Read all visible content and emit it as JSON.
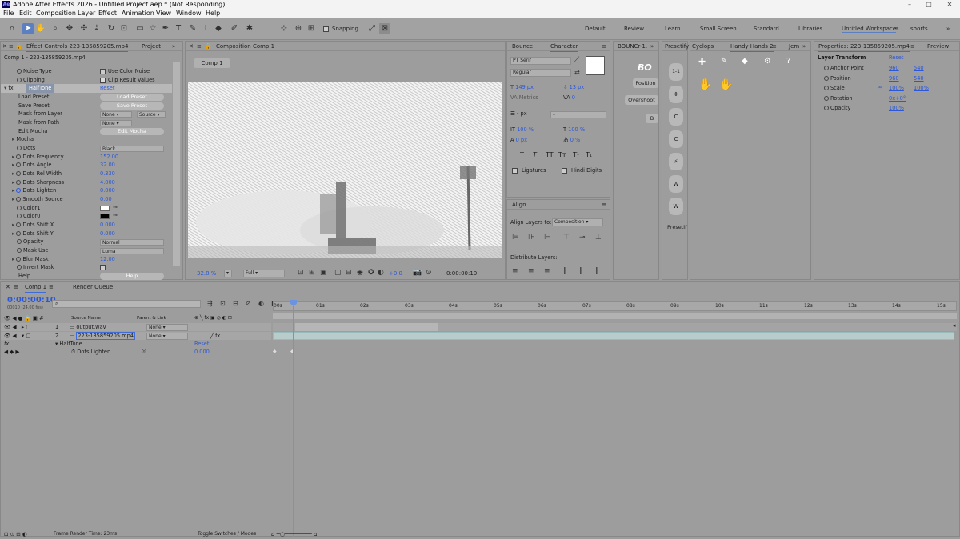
{
  "app": {
    "logo_text": "Ae",
    "title": "Adobe After Effects 2026 - Untitled Project.aep * (Not Responding)"
  },
  "menu": [
    "File",
    "Edit",
    "Composition",
    "Layer",
    "Effect",
    "Animation",
    "View",
    "Window",
    "Help"
  ],
  "toolbar": {
    "snapping_label": "Snapping"
  },
  "workspaces": [
    "Default",
    "Review",
    "Learn",
    "Small Screen",
    "Standard",
    "Libraries",
    "Untitled Workspace",
    "shorts"
  ],
  "effect_controls": {
    "tab_label": "Effect Controls 223-135859205.mp4",
    "project_tab": "Project",
    "breadcrumb": "Comp 1 - 223-135859205.mp4",
    "effect_name": "HalfTone",
    "reset": "Reset",
    "rows": [
      {
        "label": "Noise Type",
        "control": "Use Color Noise"
      },
      {
        "label": "Clipping",
        "control": "Clip Result Values"
      },
      {
        "label": "Load Preset",
        "control": "Load Preset"
      },
      {
        "label": "Save Preset",
        "control": "Save Preset"
      },
      {
        "label": "Mask from Layer",
        "control": "None",
        "control2": "Source"
      },
      {
        "label": "Mask from Path",
        "control": "None"
      },
      {
        "label": "Edit Mocha",
        "control": "Edit Mocha"
      },
      {
        "label": "Mocha",
        "control": ""
      },
      {
        "label": "Dots",
        "control": "Black"
      },
      {
        "label": "Dots Frequency",
        "control": "152.00"
      },
      {
        "label": "Dots Angle",
        "control": "32.00"
      },
      {
        "label": "Dots Rel Width",
        "control": "0.330"
      },
      {
        "label": "Dots Sharpness",
        "control": "4.000"
      },
      {
        "label": "Dots Lighten",
        "control": "0.000"
      },
      {
        "label": "Smooth Source",
        "control": "0.00"
      },
      {
        "label": "Color1",
        "control": ""
      },
      {
        "label": "Color0",
        "control": ""
      },
      {
        "label": "Dots Shift X",
        "control": "0.000"
      },
      {
        "label": "Dots Shift Y",
        "control": "0.000"
      },
      {
        "label": "Opacity",
        "control": "Normal"
      },
      {
        "label": "Mask Use",
        "control": "Luma"
      },
      {
        "label": "Blur Mask",
        "control": "12.00"
      },
      {
        "label": "Invert Mask",
        "control": ""
      },
      {
        "label": "Help",
        "control": "Help"
      }
    ]
  },
  "composition": {
    "tab_label": "Composition Comp 1",
    "comp_chip": "Comp 1",
    "zoom": "32.8 %",
    "resolution": "Full",
    "exposure": "+0.0",
    "timecode": "0:00:00:10"
  },
  "character": {
    "tabs": [
      "Bounce",
      "Character"
    ],
    "font": "PT Serif",
    "style": "Regular",
    "size": "149 px",
    "leading": "13 px",
    "kerning": "Metrics",
    "tracking": "0",
    "stroke": "- px",
    "vscale": "100 %",
    "hscale": "100 %",
    "baseline": "0 px",
    "tsume": "0 %",
    "ligatures": "Ligatures",
    "hindi_digits": "Hindi Digits",
    "type_buttons": [
      "T",
      "T",
      "TT",
      "Tт",
      "T¹",
      "T₁"
    ]
  },
  "align": {
    "title": "Align",
    "align_to_label": "Align Layers to:",
    "align_to_value": "Composition",
    "distribute_label": "Distribute Layers:"
  },
  "bouncr": {
    "tab": "BOUNCr-1.",
    "logo": "BO",
    "position": "Position",
    "overshoot": "Overshoot",
    "b": "B"
  },
  "presets": {
    "tab": "Presetify",
    "footer": "Presetif",
    "buttons": [
      "1-1",
      "⇕",
      "C",
      "C",
      "⚡",
      "W",
      "W"
    ]
  },
  "handy_hands": {
    "tabs": [
      "Cyclops",
      "Handy Hands 2",
      "Jem"
    ]
  },
  "properties": {
    "tab": "Properties: 223-135859205.mp4",
    "preview_tab": "Preview",
    "section": "Layer Transform",
    "reset": "Reset",
    "rows": [
      {
        "label": "Anchor Point",
        "v1": "960",
        "v2": "540"
      },
      {
        "label": "Position",
        "v1": "960",
        "v2": "540"
      },
      {
        "label": "Scale",
        "v1": "100%",
        "v2": "100%"
      },
      {
        "label": "Rotation",
        "v1": "0x+0°",
        "v2": ""
      },
      {
        "label": "Opacity",
        "v1": "100%",
        "v2": ""
      }
    ]
  },
  "timeline": {
    "tab": "Comp 1",
    "render_queue": "Render Queue",
    "timecode": "0:00:00:10",
    "fps_info": "00010 (24.00 fps)",
    "col_source": "Source Name",
    "col_parent": "Parent & Link",
    "layers": [
      {
        "num": "1",
        "name": "output.wav",
        "parent": "None"
      },
      {
        "num": "2",
        "name": "223-135859205.mp4",
        "parent": "None"
      }
    ],
    "effect": "HalfTone",
    "effect_reset": "Reset",
    "prop": "Dots Lighten",
    "prop_value": "0.000",
    "ruler": [
      "00s",
      "01s",
      "02s",
      "03s",
      "04s",
      "05s",
      "06s",
      "07s",
      "08s",
      "09s",
      "10s",
      "11s",
      "12s",
      "13s",
      "14s",
      "15s"
    ],
    "footer_render": "Frame Render Time: 23ms",
    "footer_toggle": "Toggle Switches / Modes"
  }
}
